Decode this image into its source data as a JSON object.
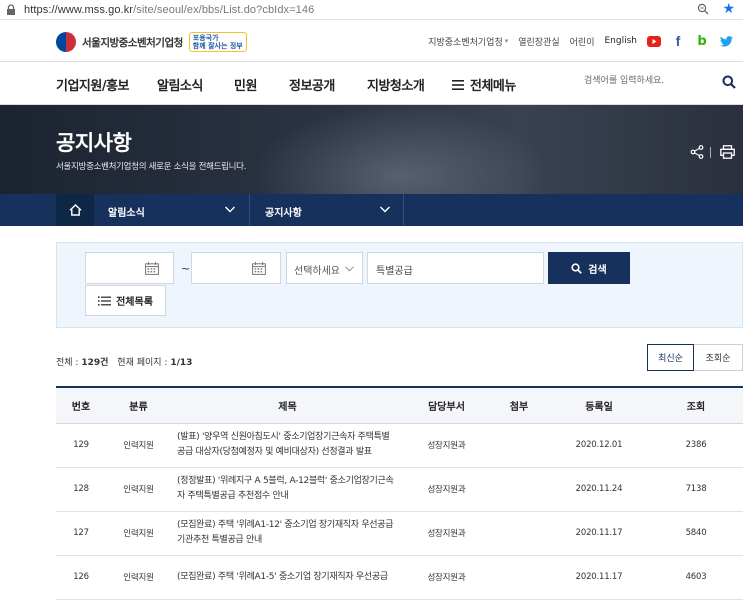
{
  "browser": {
    "url_host": "https://www.mss.go.kr",
    "url_path": "/site/seoul/ex/bbs/List.do?cbIdx=146"
  },
  "header": {
    "org_name": "서울지방중소벤처기업청",
    "slogan_line1": "포용국가",
    "slogan_line2": "함께 잘사는 정부",
    "links": [
      "지방중소벤처기업청",
      "열린장관실",
      "어린이",
      "English"
    ],
    "social": [
      "youtube",
      "facebook",
      "blog",
      "twitter"
    ],
    "brand_color": "#16325c"
  },
  "nav": {
    "items": [
      "기업지원/홍보",
      "알림소식",
      "민원",
      "정보공개",
      "지방청소개"
    ],
    "all_menu": "전체메뉴",
    "search_placeholder": "검색어를 입력하세요."
  },
  "hero": {
    "title": "공지사항",
    "subtitle": "서울지방중소벤처기업청의 새로운 소식을 전해드립니다."
  },
  "breadcrumb": {
    "level1": "알림소식",
    "level2": "공지사항"
  },
  "search": {
    "date_from": "",
    "date_to": "",
    "tilde": "~",
    "select_value": "선택하세요",
    "keyword": "특별공급",
    "search_button": "검색",
    "list_all_button": "전체목록"
  },
  "summary": {
    "total_label": "전체 :",
    "total_value": "129건",
    "page_label": "현재 페이지 :",
    "page_value": "1/13"
  },
  "sort": {
    "latest": "최신순",
    "views": "조회순"
  },
  "table": {
    "headers": [
      "번호",
      "분류",
      "제목",
      "담당부서",
      "첨부",
      "등록일",
      "조회"
    ],
    "rows": [
      {
        "no": "129",
        "category": "인력지원",
        "title_1": "(발표) '양우역 신원아침도시' 중소기업장기근속자 주택특별",
        "title_2": "공급 대상자(당첨예정자 및 예비대상자) 선정결과 발표",
        "dept": "성장지원과",
        "date": "2020.12.01",
        "views": "2386"
      },
      {
        "no": "128",
        "category": "인력지원",
        "title_1": "(정정발표) '위례지구 A 5블럭, A-12블럭' 중소기업장기근속",
        "title_2": "자 주택특별공급 추천점수 안내",
        "dept": "성장지원과",
        "date": "2020.11.24",
        "views": "7138"
      },
      {
        "no": "127",
        "category": "인력지원",
        "title_1": "(모집완료) 주택 '위례A1-12' 중소기업 장기재직자 우선공급",
        "title_2": "기관추천 특별공급 안내",
        "dept": "성장지원과",
        "date": "2020.11.17",
        "views": "5840"
      },
      {
        "no": "126",
        "category": "인력지원",
        "title_1": "(모집완료) 주택 '위례A1-5' 중소기업 장기재직자 우선공급",
        "title_2": "",
        "dept": "성장지원과",
        "date": "2020.11.17",
        "views": "4603"
      }
    ]
  }
}
